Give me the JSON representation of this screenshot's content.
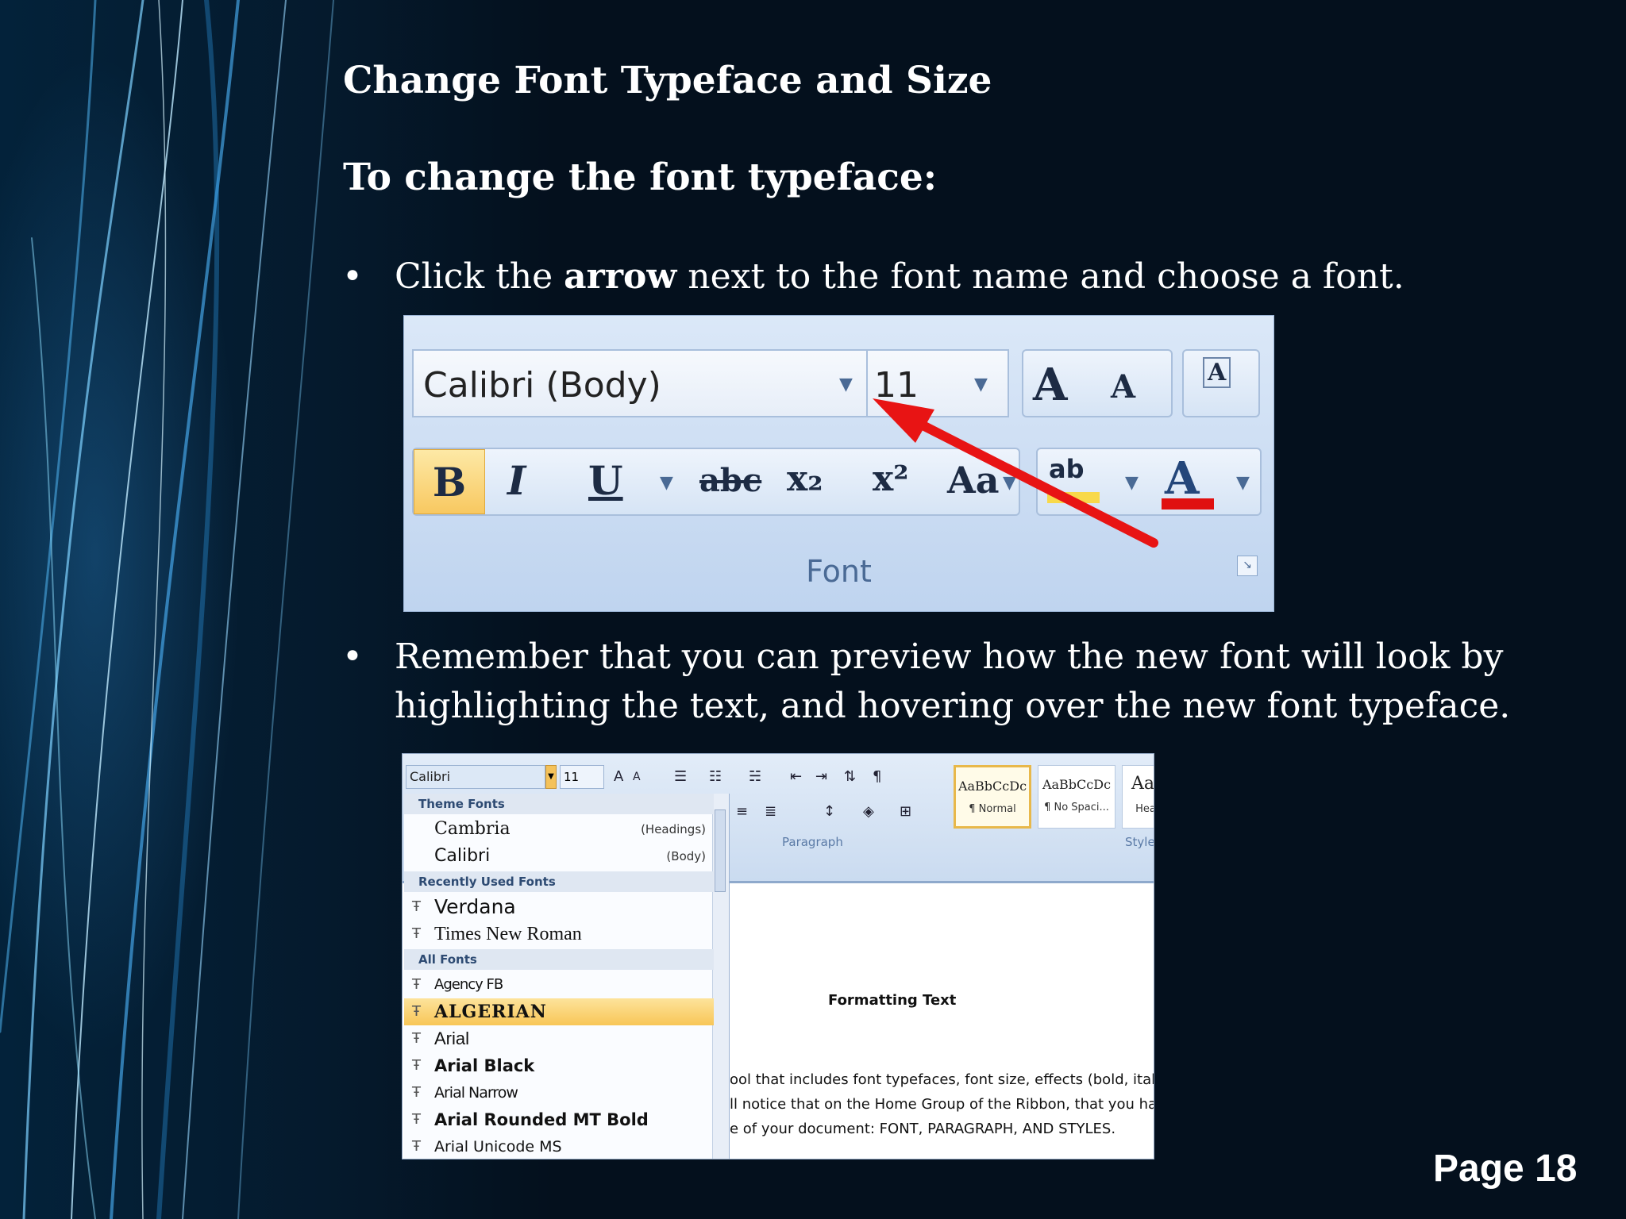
{
  "slide": {
    "heading": "Change Font Typeface and Size",
    "subheading": "To change the font typeface:",
    "bullet1": {
      "prefix": "Click the ",
      "bold": "arrow",
      "suffix": " next to the font name and choose a font."
    },
    "bullet2": "Remember that you can preview how the new font will look by highlighting the text, and hovering over the new font typeface.",
    "page_number": "Page 18"
  },
  "ribbon_image": {
    "font_name": "Calibri (Body)",
    "font_size": "11",
    "group_label": "Font",
    "buttons": {
      "grow": "A",
      "shrink": "A",
      "clear": "A",
      "bold": "B",
      "italic": "I",
      "underline": "U",
      "strike": "abc",
      "subscript": "x₂",
      "superscript": "x²",
      "change_case": "Aa",
      "highlight": "ab",
      "font_color": "A"
    },
    "colors": {
      "highlight_yellow": "#f8d94a",
      "font_color_red": "#e01010",
      "arrow_red": "#e81414"
    }
  },
  "dropdown_image": {
    "font_box": "Calibri",
    "size_box": "11",
    "paragraph_label": "Paragraph",
    "styles_label": "Style",
    "styles": [
      {
        "preview": "AaBbCcDc",
        "name": "¶ Normal"
      },
      {
        "preview": "AaBbCcDc",
        "name": "¶ No Spaci..."
      },
      {
        "preview": "Aal",
        "name": "Hea"
      }
    ],
    "sections": {
      "theme": "Theme Fonts",
      "recent": "Recently Used Fonts",
      "all": "All Fonts"
    },
    "theme_fonts": [
      {
        "name": "Cambria",
        "tag": "(Headings)"
      },
      {
        "name": "Calibri",
        "tag": "(Body)"
      }
    ],
    "recent_fonts": [
      "Verdana",
      "Times New Roman"
    ],
    "all_fonts": [
      "Agency FB",
      "ALGERIAN",
      "Arial",
      "Arial Black",
      "Arial Narrow",
      "Arial Rounded MT Bold",
      "Arial Unicode MS"
    ],
    "doc": {
      "title": "Formatting Text",
      "line1": "ool that includes font typefaces, font size, effects (bold, italics",
      "line2": "ll notice that on the Home Group of the Ribbon, that you have",
      "line3": "e of your document:  FONT, PARAGRAPH, AND STYLES."
    }
  }
}
